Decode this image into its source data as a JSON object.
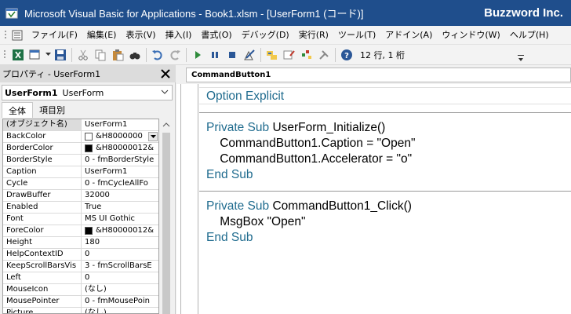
{
  "window": {
    "title": "Microsoft Visual Basic for Applications - Book1.xlsm - [UserForm1 (コード)]",
    "brand": "Buzzword Inc."
  },
  "menu": {
    "items": [
      {
        "label": "ファイル(F)"
      },
      {
        "label": "編集(E)"
      },
      {
        "label": "表示(V)"
      },
      {
        "label": "挿入(I)"
      },
      {
        "label": "書式(O)"
      },
      {
        "label": "デバッグ(D)"
      },
      {
        "label": "実行(R)"
      },
      {
        "label": "ツール(T)"
      },
      {
        "label": "アドイン(A)"
      },
      {
        "label": "ウィンドウ(W)"
      },
      {
        "label": "ヘルプ(H)"
      }
    ]
  },
  "toolbar": {
    "position_text": "12 行, 1 桁",
    "icons": [
      "excel-icon",
      "insert-form-icon",
      "save-icon",
      "cut-icon",
      "copy-icon",
      "paste-icon",
      "find-icon",
      "undo-icon",
      "redo-icon",
      "run-icon",
      "break-icon",
      "reset-icon",
      "design-mode-icon",
      "project-explorer-icon",
      "properties-window-icon",
      "object-browser-icon",
      "toolbox-icon",
      "help-icon"
    ]
  },
  "properties": {
    "title": "プロパティ - UserForm1",
    "object_name": "UserForm1",
    "object_type": "UserForm",
    "tabs": [
      {
        "label": "全体"
      },
      {
        "label": "項目別"
      }
    ],
    "rows": [
      {
        "name": "(オブジェクト名)",
        "value": "UserForm1"
      },
      {
        "name": "BackColor",
        "value": "&H8000000",
        "swatch": "#ffffff",
        "dropdown": true
      },
      {
        "name": "BorderColor",
        "value": "&H80000012&",
        "swatch": "#000000"
      },
      {
        "name": "BorderStyle",
        "value": "0 - fmBorderStyle"
      },
      {
        "name": "Caption",
        "value": "UserForm1"
      },
      {
        "name": "Cycle",
        "value": "0 - fmCycleAllFo"
      },
      {
        "name": "DrawBuffer",
        "value": "32000"
      },
      {
        "name": "Enabled",
        "value": "True"
      },
      {
        "name": "Font",
        "value": "MS UI Gothic"
      },
      {
        "name": "ForeColor",
        "value": "&H80000012&",
        "swatch": "#000000"
      },
      {
        "name": "Height",
        "value": "180"
      },
      {
        "name": "HelpContextID",
        "value": "0"
      },
      {
        "name": "KeepScrollBarsVis",
        "value": "3 - fmScrollBarsE"
      },
      {
        "name": "Left",
        "value": "0"
      },
      {
        "name": "MouseIcon",
        "value": "(なし)"
      },
      {
        "name": "MousePointer",
        "value": "0 - fmMousePoin"
      },
      {
        "name": "Picture",
        "value": "(なし)"
      }
    ]
  },
  "code": {
    "procedure": "CommandButton1",
    "lines": [
      {
        "kw": "Option Explicit",
        "rest": ""
      },
      {
        "kw": "",
        "rest": ""
      },
      {
        "kw": "Private Sub",
        "rest": " UserForm_Initialize()"
      },
      {
        "kw": "",
        "rest": "    CommandButton1.Caption = \"Open\""
      },
      {
        "kw": "",
        "rest": "    CommandButton1.Accelerator = \"o\""
      },
      {
        "kw": "End Sub",
        "rest": ""
      },
      {
        "kw": "",
        "rest": ""
      },
      {
        "kw": "Private Sub",
        "rest": " CommandButton1_Click()"
      },
      {
        "kw": "",
        "rest": "    MsgBox \"Open\""
      },
      {
        "kw": "End Sub",
        "rest": ""
      }
    ]
  }
}
